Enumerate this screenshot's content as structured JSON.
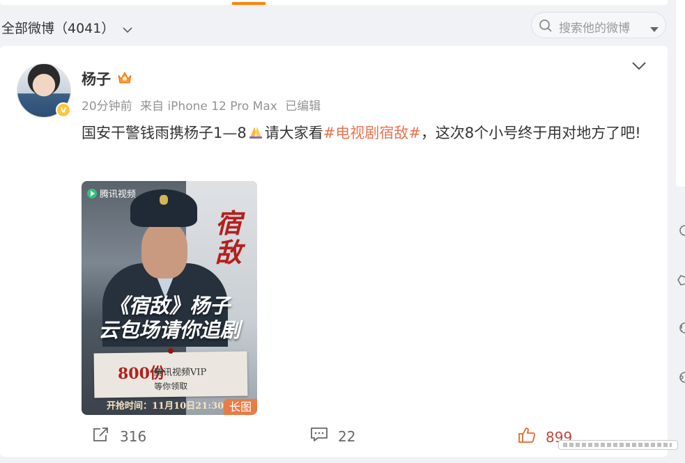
{
  "filter": {
    "label": "全部微博（4041）",
    "search_placeholder": "搜索他的微博"
  },
  "post": {
    "author": "杨子",
    "time": "20分钟前",
    "source": "来自 iPhone 12 Pro Max",
    "edited": "已编辑",
    "text_before_tag": "国安干警钱雨携杨子1—8",
    "text_mid": "请大家看",
    "hashtag": "#电视剧宿敌#",
    "text_after_tag": "，这次8个小号终于用对地方了吧!",
    "emoji": "praying-hands"
  },
  "poster": {
    "logo_text": "腾讯视频",
    "calligraphy": "宿敌",
    "headline_line1": "《宿敌》杨子",
    "headline_line2": "云包场请你追剧",
    "amount": "800份",
    "vip_text": "腾讯视频VIP",
    "receive_text": "等你领取",
    "grab_time": "开抢时间：11月10日21:30",
    "badge": "长图"
  },
  "actions": {
    "forward_count": "316",
    "comment_count": "22",
    "like_count": "899"
  },
  "colors": {
    "accent_orange": "#ff8200",
    "hashtag": "#eb7350",
    "like": "#c0473a",
    "verified_badge": "#ffc53d"
  }
}
